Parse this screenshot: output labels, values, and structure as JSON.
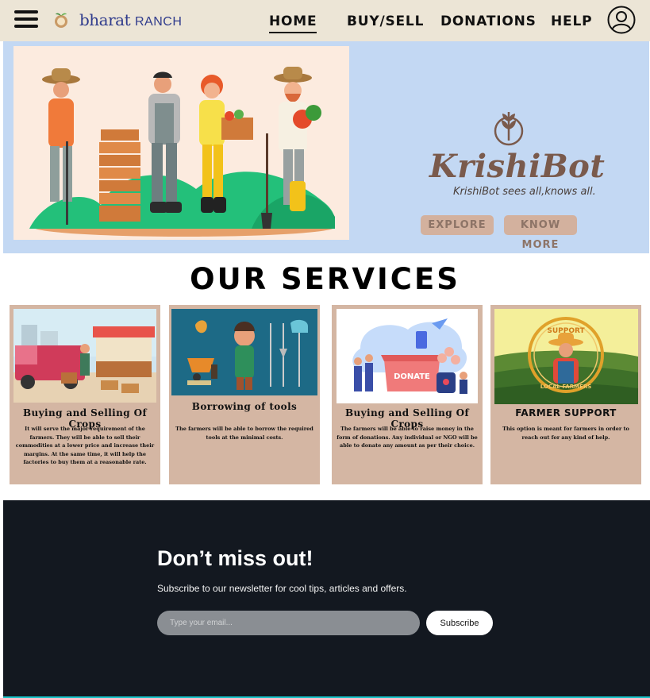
{
  "nav": {
    "menu_icon": "hamburger-icon",
    "logo": {
      "brand": "bharat",
      "suffix": "RANCH"
    },
    "links": [
      {
        "label": "HOME",
        "active": true
      },
      {
        "label": "BUY/SELL",
        "active": false
      },
      {
        "label": "DONATIONS",
        "active": false
      },
      {
        "label": "HELP",
        "active": false
      }
    ],
    "profile_icon": "user-avatar-icon"
  },
  "hero": {
    "icon": "wheat-leaf-icon",
    "title": "KrishiBot",
    "tagline": "KrishiBot sees all,knows all.",
    "buttons": {
      "explore": "EXPLORE",
      "know_more": "KNOW MORE"
    }
  },
  "services": {
    "title": "OUR SERVICES",
    "cards": [
      {
        "title": "Buying and Selling Of Crops",
        "desc": "It will serve the major requirement of the farmers. They will be able to sell their commodities at a lower price and increase their margins. At the same time, it will help the factories to buy them at a reasonable rate."
      },
      {
        "title": "Borrowing of tools",
        "desc": "The farmers will be able to borrow the required tools at the minimal costs."
      },
      {
        "title": "Buying and Selling Of Crops",
        "desc": "The farmers will be able to raise money in the form of donations. Any individual or NGO will be able to donate any amount as per their choice.",
        "image_label": "DONATE"
      },
      {
        "title": "FARMER SUPPORT",
        "desc": "This option is meant for farmers in order to reach out for any kind of help.",
        "image_label_top": "SUPPORT",
        "image_label_bottom": "LOCAL FARMERS"
      }
    ]
  },
  "newsletter": {
    "title": "Don’t miss out!",
    "subtitle": "Subscribe to our newsletter for cool tips, articles and offers.",
    "email_placeholder": "Type your email...",
    "button": "Subscribe"
  },
  "colors": {
    "nav_bg": "#ece5d6",
    "hero_bg": "#c3d8f3",
    "card_bg": "#d4b6a3",
    "brand_brown": "#7a5a4c",
    "footer_bg": "#131820"
  }
}
